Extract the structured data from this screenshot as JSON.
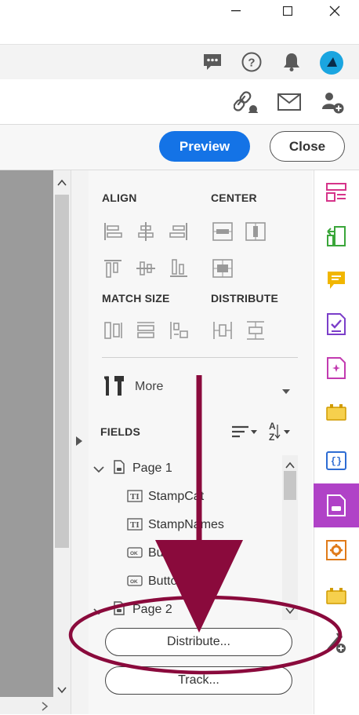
{
  "window": {
    "minimize_icon": "minimize-icon",
    "maximize_icon": "maximize-icon",
    "close_icon": "close-icon"
  },
  "header": {
    "icons": [
      "chat-icon",
      "help-icon",
      "bell-icon",
      "profile-icon"
    ]
  },
  "share_bar": {
    "icons": [
      "share-link-icon",
      "email-icon",
      "add-user-icon"
    ]
  },
  "action_bar": {
    "preview_label": "Preview",
    "close_label": "Close"
  },
  "panel": {
    "align_label": "ALIGN",
    "center_label": "CENTER",
    "match_size_label": "MATCH SIZE",
    "distribute_label": "DISTRIBUTE",
    "more_label": "More",
    "fields_label": "FIELDS",
    "tree": [
      {
        "label": "Page 1",
        "type": "page"
      },
      {
        "label": "StampCat",
        "type": "text-field"
      },
      {
        "label": "StampNames",
        "type": "text-field"
      },
      {
        "label": "Butt",
        "type": "button"
      },
      {
        "label": "Butto",
        "type": "button"
      },
      {
        "label": "Page 2",
        "type": "page"
      }
    ],
    "distribute_button": "Distribute...",
    "track_button": "Track..."
  },
  "right_tools": [
    "organize-pages-icon",
    "export-pdf-icon",
    "comment-icon",
    "fill-sign-icon",
    "edit-pdf-icon",
    "stamp-icon",
    "javascript-icon",
    "prepare-form-icon",
    "action-wizard-icon",
    "stamp-icon",
    "customize-tools-icon"
  ],
  "colors": {
    "accent": "#1473e6",
    "annotation": "#8a0a3c",
    "active_tool": "#b042c7"
  }
}
